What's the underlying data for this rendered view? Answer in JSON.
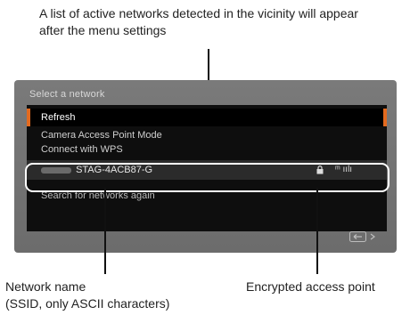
{
  "callouts": {
    "top": "A list of active networks detected in the vicinity will appear after the menu settings",
    "network_name_line1": "Network name",
    "network_name_line2": "(SSID, only ASCII characters)",
    "encrypted": "Encrypted access point"
  },
  "screen": {
    "title": "Select a network",
    "menu": {
      "refresh": "Refresh",
      "camera_ap_mode": "Camera Access Point Mode",
      "connect_wps": "Connect with WPS",
      "network_ssid": "STAG-4ACB87-G",
      "network_signal": "ᵐ ıılı",
      "search_again": "Search for networks again"
    },
    "icons": {
      "lock": "lock-icon",
      "signal": "signal-strength-icon",
      "back": "back-button-icon"
    },
    "colors": {
      "highlight": "#e36a1f",
      "panel": "#0e0e0e",
      "screen_bg": "#727272"
    }
  }
}
